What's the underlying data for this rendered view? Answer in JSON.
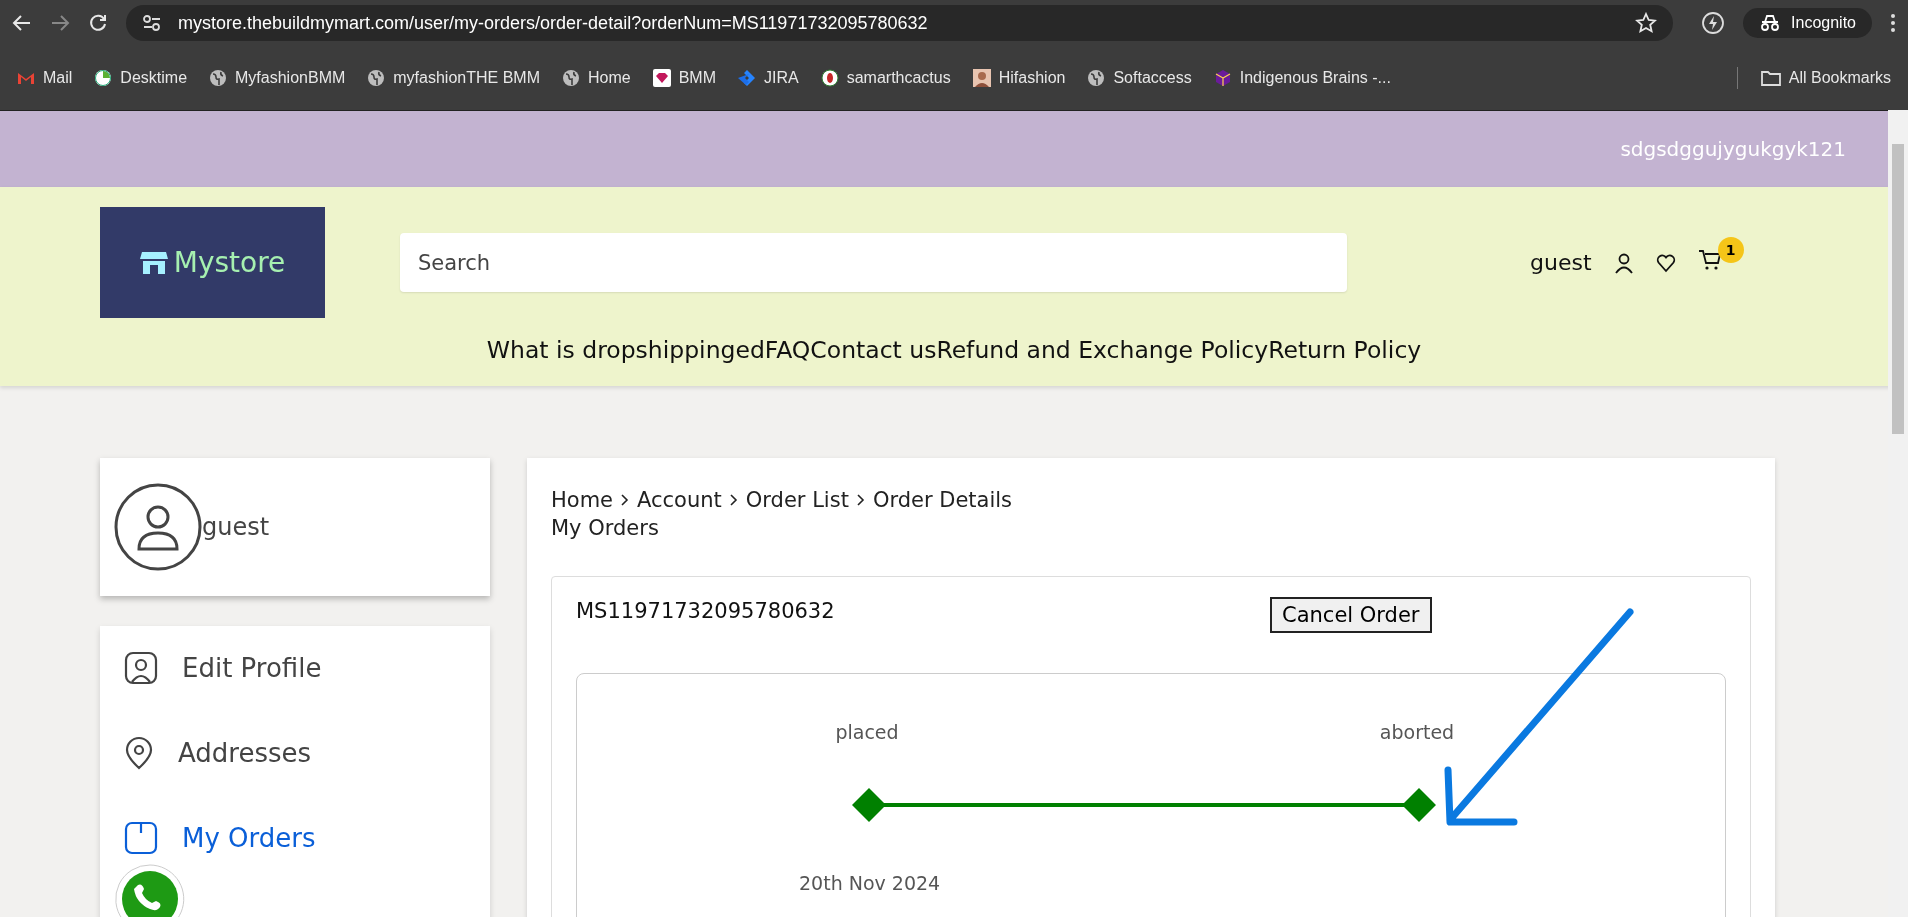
{
  "browser": {
    "url": "mystore.thebuildmymart.com/user/my-orders/order-detail?orderNum=MS11971732095780632",
    "profile": "Incognito",
    "bookmarks": [
      {
        "label": "Mail",
        "kind": "mail"
      },
      {
        "label": "Desktime",
        "kind": "clock"
      },
      {
        "label": "MyfashionBMM",
        "kind": "globe"
      },
      {
        "label": "myfashionTHE BMM",
        "kind": "globe"
      },
      {
        "label": "Home",
        "kind": "globe"
      },
      {
        "label": "BMM",
        "kind": "gem"
      },
      {
        "label": "JIRA",
        "kind": "jira"
      },
      {
        "label": "samarthcactus",
        "kind": "leaf"
      },
      {
        "label": "Hifashion",
        "kind": "figure"
      },
      {
        "label": "Softaccess",
        "kind": "globe"
      },
      {
        "label": "Indigenous Brains -...",
        "kind": "cube"
      }
    ],
    "all_bookmarks": "All Bookmarks"
  },
  "topbar": {
    "text": "sdgsdggujygukgyk121"
  },
  "header": {
    "logo": "Mystore",
    "search_placeholder": "Search",
    "user": "guest",
    "cart_count": "1",
    "nav": [
      "What is dropshippinged",
      "FAQ",
      "Contact us",
      "Refund and Exchange Policy",
      "Return Policy"
    ]
  },
  "profile": {
    "name": "guest"
  },
  "sidebar": {
    "items": [
      {
        "label": "Edit Profile",
        "kind": "profile",
        "selected": false
      },
      {
        "label": "Addresses",
        "kind": "pin",
        "selected": false
      },
      {
        "label": "My Orders",
        "kind": "orders",
        "selected": true
      }
    ]
  },
  "breadcrumb": [
    "Home",
    "Account",
    "Order List",
    "Order Details"
  ],
  "page_title": "My Orders",
  "order": {
    "number": "MS11971732095780632",
    "cancel_button": "Cancel Order",
    "steps": [
      {
        "label": "placed",
        "done": true
      },
      {
        "label": "aborted",
        "done": true
      }
    ],
    "date": "20th Nov 2024"
  }
}
